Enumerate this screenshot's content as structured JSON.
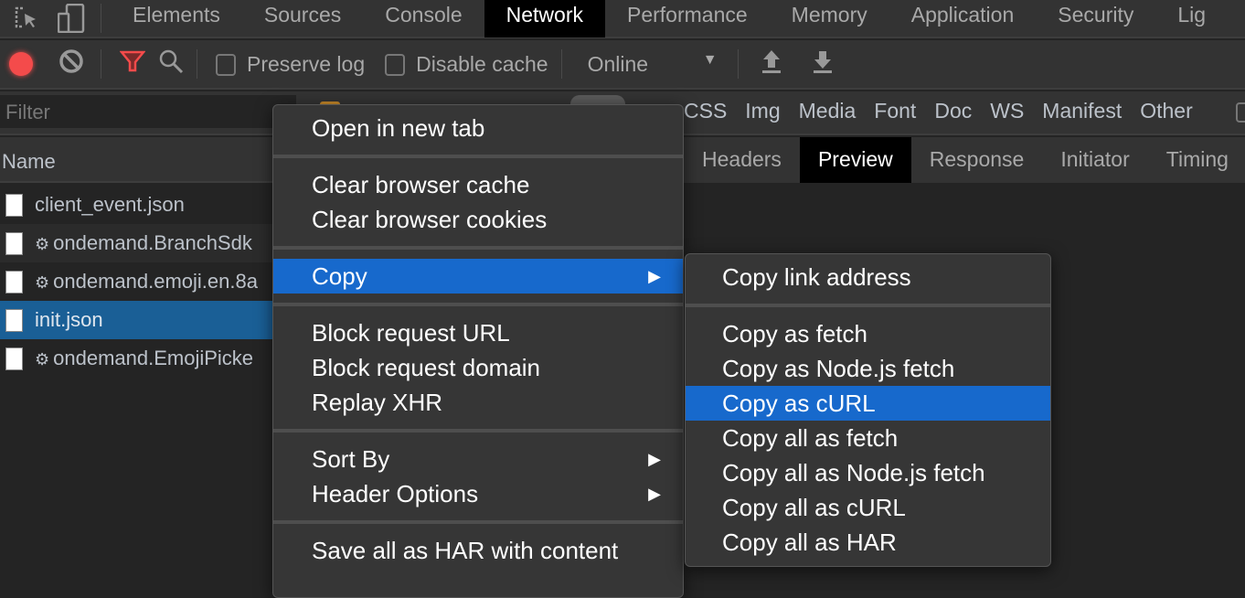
{
  "tabs": [
    "Elements",
    "Sources",
    "Console",
    "Network",
    "Performance",
    "Memory",
    "Application",
    "Security",
    "Lig"
  ],
  "active_tab": "Network",
  "toolbar": {
    "preserve_log": "Preserve log",
    "disable_cache": "Disable cache",
    "throttle": "Online"
  },
  "filter": {
    "placeholder": "Filter",
    "types": [
      "CSS",
      "Img",
      "Media",
      "Font",
      "Doc",
      "WS",
      "Manifest",
      "Other"
    ]
  },
  "name_header": "Name",
  "detail_tabs": [
    "Headers",
    "Preview",
    "Response",
    "Initiator",
    "Timing"
  ],
  "active_detail_tab": "Preview",
  "requests": [
    {
      "name": "client_event.json",
      "gear": false
    },
    {
      "name": "ondemand.BranchSdk",
      "gear": true
    },
    {
      "name": "ondemand.emoji.en.8a",
      "gear": true
    },
    {
      "name": "init.json",
      "gear": false,
      "selected": true
    },
    {
      "name": "ondemand.EmojiPicke",
      "gear": true
    }
  ],
  "context_menu": {
    "groups": [
      [
        "Open in new tab"
      ],
      [
        "Clear browser cache",
        "Clear browser cookies"
      ],
      [
        "Copy"
      ],
      [
        "Block request URL",
        "Block request domain",
        "Replay XHR"
      ],
      [
        "Sort By",
        "Header Options"
      ],
      [
        "Save all as HAR with content"
      ]
    ],
    "highlighted": "Copy",
    "submenu_items": [
      "Copy",
      "Sort By",
      "Header Options"
    ]
  },
  "copy_submenu": {
    "groups": [
      [
        "Copy link address"
      ],
      [
        "Copy as fetch",
        "Copy as Node.js fetch",
        "Copy as cURL",
        "Copy all as fetch",
        "Copy all as Node.js fetch",
        "Copy all as cURL",
        "Copy all as HAR"
      ]
    ],
    "highlighted": "Copy as cURL"
  },
  "colors": {
    "record": "#f44b4b",
    "filter_active": "#f44b4b",
    "highlight": "#1769cc",
    "selected_row": "#1a5f96"
  }
}
